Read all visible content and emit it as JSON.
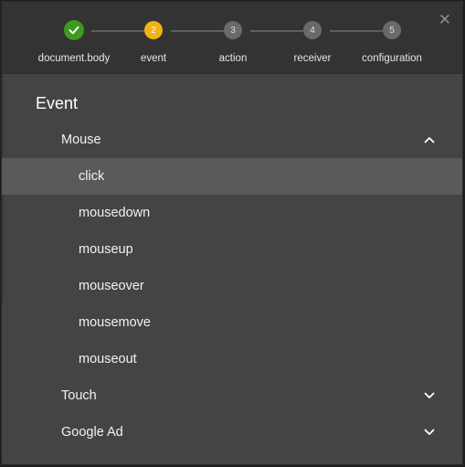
{
  "stepper": {
    "steps": [
      {
        "label": "document.body",
        "number": "",
        "state": "done"
      },
      {
        "label": "event",
        "number": "2",
        "state": "active"
      },
      {
        "label": "action",
        "number": "3",
        "state": "pending"
      },
      {
        "label": "receiver",
        "number": "4",
        "state": "pending"
      },
      {
        "label": "configuration",
        "number": "5",
        "state": "pending"
      }
    ],
    "close_icon": "close-icon",
    "close_glyph": "✕",
    "done_icon": "check-icon"
  },
  "panel": {
    "title": "Event",
    "groups": [
      {
        "label": "Mouse",
        "expanded": true,
        "icon": "chevron-up-icon",
        "items": [
          "click",
          "mousedown",
          "mouseup",
          "mouseover",
          "mousemove",
          "mouseout"
        ],
        "selected": "click"
      },
      {
        "label": "Touch",
        "expanded": false,
        "icon": "chevron-down-icon"
      },
      {
        "label": "Google Ad",
        "expanded": false,
        "icon": "chevron-down-icon"
      }
    ]
  },
  "colors": {
    "done": "#3d9a1e",
    "active": "#f0b414",
    "pending": "#6a6a6a",
    "panel_bg": "#444444",
    "header_bg": "#333333",
    "selected_row": "#5a5a5a"
  }
}
